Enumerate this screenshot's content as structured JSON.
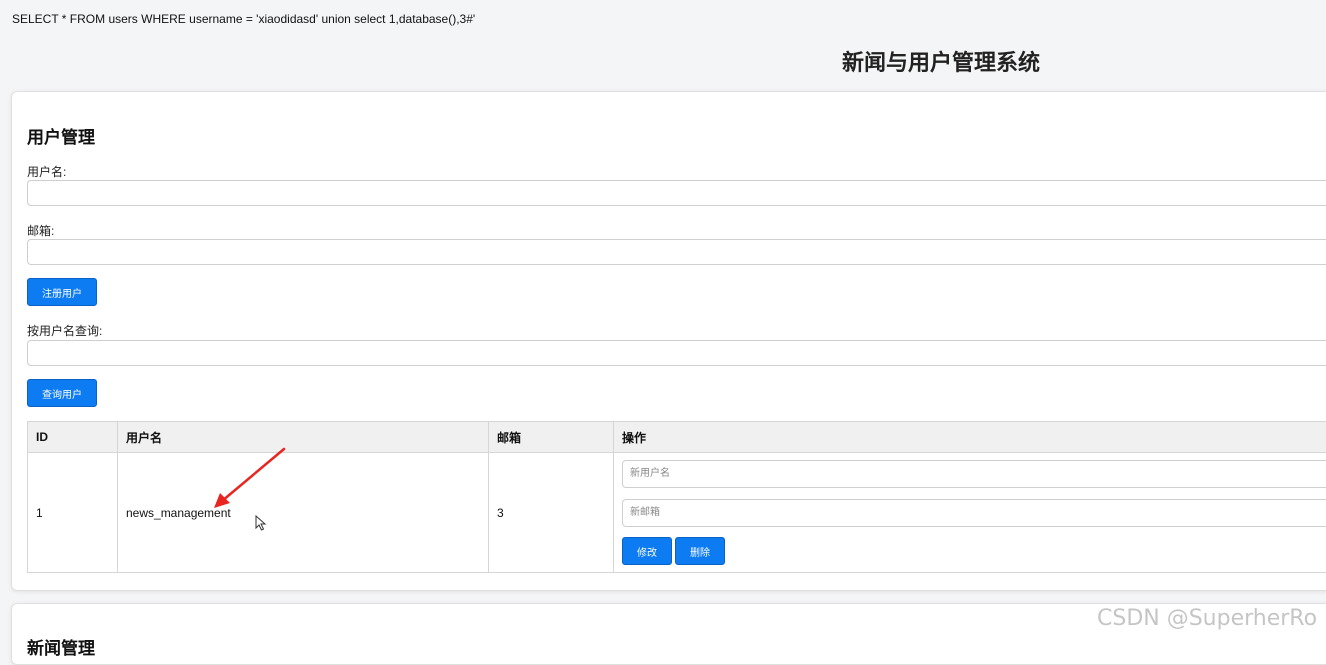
{
  "query": {
    "sql": "SELECT * FROM users WHERE username = 'xiaodidasd' union select 1,database(),3#'"
  },
  "page": {
    "title": "新闻与用户管理系统"
  },
  "user_section": {
    "title": "用户管理",
    "username_label": "用户名:",
    "username_value": "",
    "email_label": "邮箱:",
    "email_value": "",
    "register_button": "注册用户",
    "search_label": "按用户名查询:",
    "search_value": "",
    "search_button": "查询用户",
    "table": {
      "headers": [
        "ID",
        "用户名",
        "邮箱",
        "操作"
      ],
      "rows": [
        {
          "id": "1",
          "username": "news_management",
          "email": "3",
          "new_username_placeholder": "新用户名",
          "new_email_placeholder": "新邮箱",
          "edit_button": "修改",
          "delete_button": "删除"
        }
      ]
    }
  },
  "news_section": {
    "title": "新闻管理"
  },
  "annotations": {
    "arrow_color": "#e8251f"
  },
  "watermark": "CSDN @SuperherRo",
  "theme": {
    "primary_button": "#0d7bf2"
  }
}
